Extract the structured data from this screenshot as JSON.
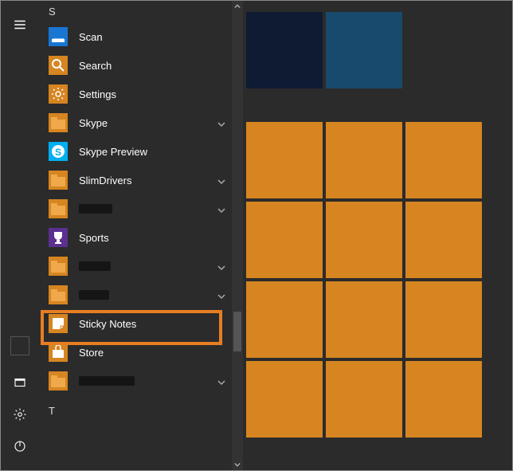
{
  "letters": {
    "s": "S",
    "t": "T"
  },
  "apps": {
    "scan": "Scan",
    "search": "Search",
    "settings": "Settings",
    "skype": "Skype",
    "skype_preview": "Skype Preview",
    "slimdrivers": "SlimDrivers",
    "sports": "Sports",
    "sticky_notes": "Sticky Notes",
    "store": "Store"
  },
  "redacted_widths": {
    "r1": 42,
    "r2": 40,
    "r3": 38,
    "r4": 70
  },
  "colors": {
    "accent": "#d68521",
    "highlight": "#e67e22",
    "navy1": "#0e1b33",
    "navy2": "#174a6c"
  }
}
